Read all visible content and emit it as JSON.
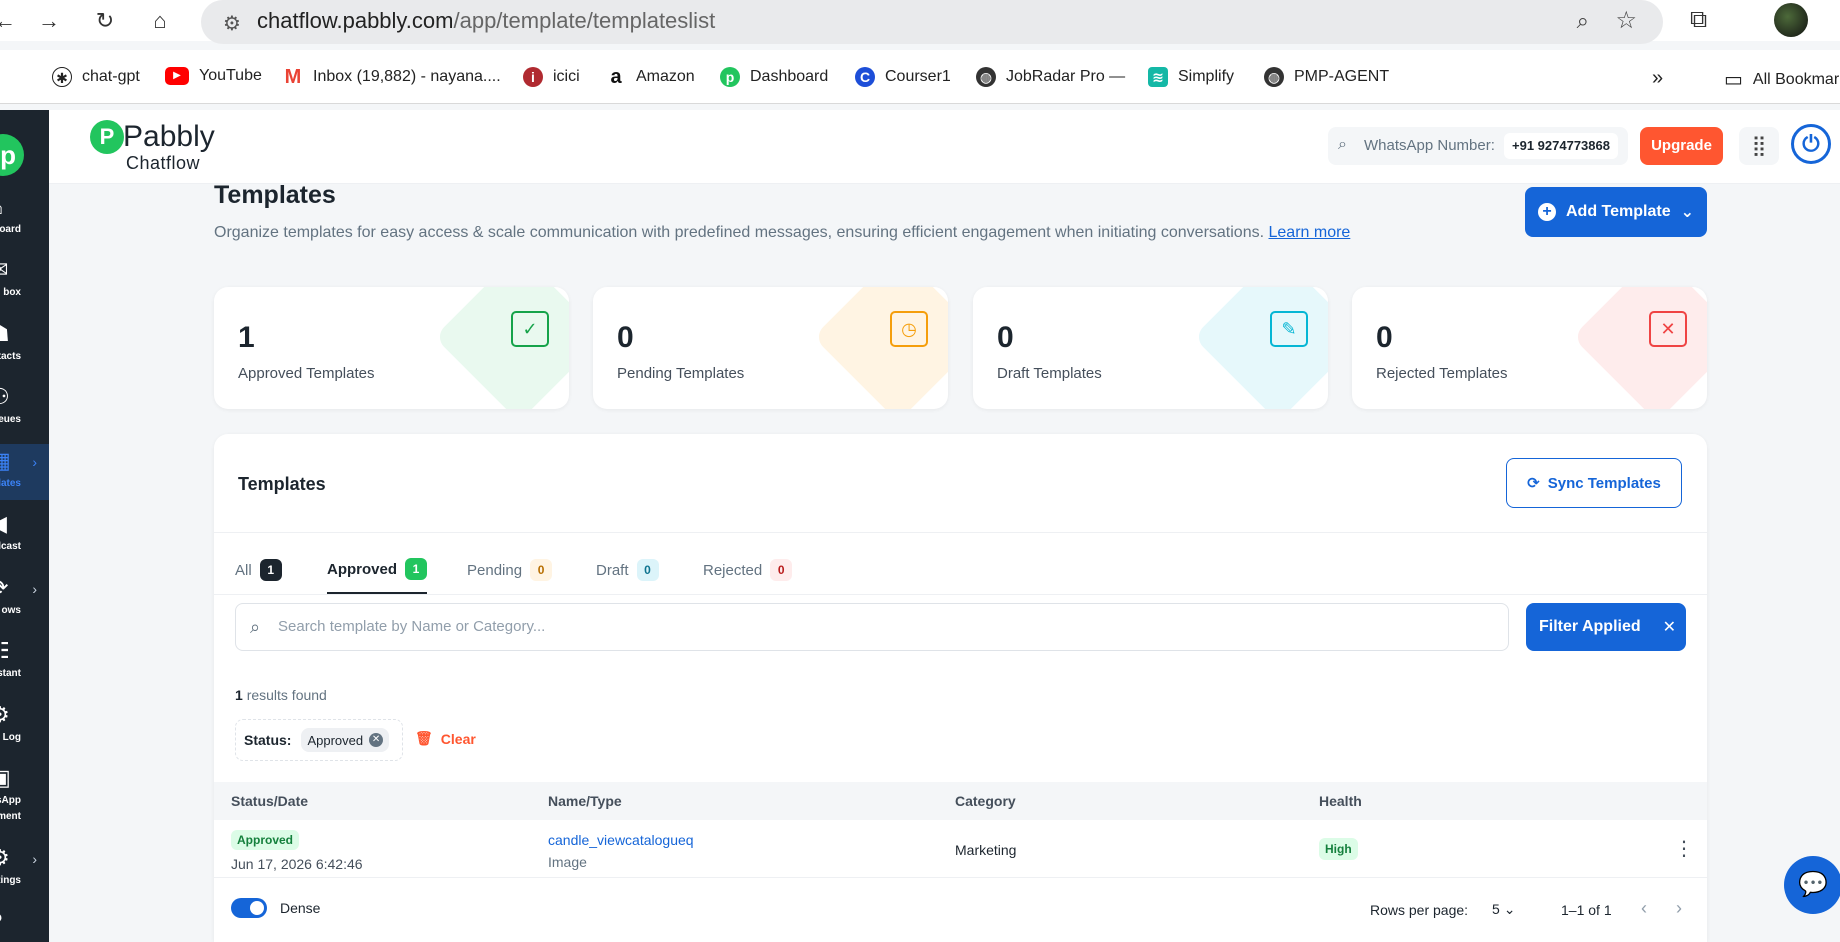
{
  "browser": {
    "url_host": "chatflow.pabbly.com",
    "url_path": "/app/template/templateslist",
    "bookmarks": [
      {
        "label": "chat-gpt",
        "icon": "openai-icon"
      },
      {
        "label": "YouTube",
        "icon": "youtube-icon"
      },
      {
        "label": "Inbox (19,882) - nayana....",
        "icon": "gmail-icon"
      },
      {
        "label": "icici",
        "icon": "icici-icon"
      },
      {
        "label": "Amazon",
        "icon": "amazon-icon"
      },
      {
        "label": "Dashboard",
        "icon": "pabbly-icon"
      },
      {
        "label": "Courser1",
        "icon": "coursera-icon"
      },
      {
        "label": "JobRadar Pro —",
        "icon": "globe-icon"
      },
      {
        "label": "Simplify",
        "icon": "simplify-icon"
      },
      {
        "label": "PMP-AGENT",
        "icon": "globe-icon"
      }
    ],
    "all_bookmarks": "All Bookmar"
  },
  "sidebar": {
    "items": [
      {
        "label": "board",
        "icon": "home-icon"
      },
      {
        "label": "box",
        "icon": "inbox-icon"
      },
      {
        "label": "ntacts",
        "icon": "contacts-icon"
      },
      {
        "label": "Queues",
        "icon": "queues-icon"
      },
      {
        "label": "plates",
        "icon": "templates-icon",
        "active": true
      },
      {
        "label": "dcast",
        "icon": "broadcast-icon"
      },
      {
        "label": "ows",
        "icon": "flows-icon"
      },
      {
        "label": "ssistant",
        "icon": "assistant-icon"
      },
      {
        "label": "ity Log",
        "icon": "activity-icon"
      },
      {
        "label": "tsApp",
        "label2": "ment",
        "icon": "whatsapp-icon"
      },
      {
        "label": "tings",
        "icon": "settings-icon"
      }
    ]
  },
  "header": {
    "brand_name": "Pabbly",
    "brand_sub": "Chatflow",
    "wa_label": "WhatsApp Number:",
    "wa_number": "+91 9274773868",
    "upgrade_label": "Upgrade"
  },
  "page": {
    "title": "Templates",
    "description": "Organize templates for easy access & scale communication with predefined messages, ensuring efficient engagement when initiating conversations.",
    "learn_more": "Learn more",
    "add_template_label": "Add Template"
  },
  "stats": [
    {
      "value": "1",
      "label": "Approved Templates",
      "color": "#22c55e",
      "icon": "approved-icon"
    },
    {
      "value": "0",
      "label": "Pending Templates",
      "color": "#f59e0b",
      "icon": "pending-icon"
    },
    {
      "value": "0",
      "label": "Draft Templates",
      "color": "#06b6d4",
      "icon": "draft-icon"
    },
    {
      "value": "0",
      "label": "Rejected Templates",
      "color": "#ef4444",
      "icon": "rejected-icon"
    }
  ],
  "panel": {
    "title": "Templates",
    "sync_label": "Sync Templates",
    "tabs": [
      {
        "label": "All",
        "count": "1"
      },
      {
        "label": "Approved",
        "count": "1",
        "active": true
      },
      {
        "label": "Pending",
        "count": "0"
      },
      {
        "label": "Draft",
        "count": "0"
      },
      {
        "label": "Rejected",
        "count": "0"
      }
    ],
    "search_placeholder": "Search template by Name or Category...",
    "filter_label": "Filter Applied",
    "results_count": "1",
    "results_text": "results found",
    "filter_status_label": "Status:",
    "filter_status_value": "Approved",
    "clear_label": "Clear",
    "columns": [
      "Status/Date",
      "Name/Type",
      "Category",
      "Health"
    ],
    "rows": [
      {
        "status": "Approved",
        "date": "Jun 17, 2026 6:42:46",
        "name": "candle_viewcatalogueq",
        "type": "Image",
        "category": "Marketing",
        "health": "High"
      }
    ],
    "dense_label": "Dense",
    "rows_per_page_label": "Rows per page:",
    "rows_per_page_value": "5",
    "range_text": "1–1 of 1"
  }
}
